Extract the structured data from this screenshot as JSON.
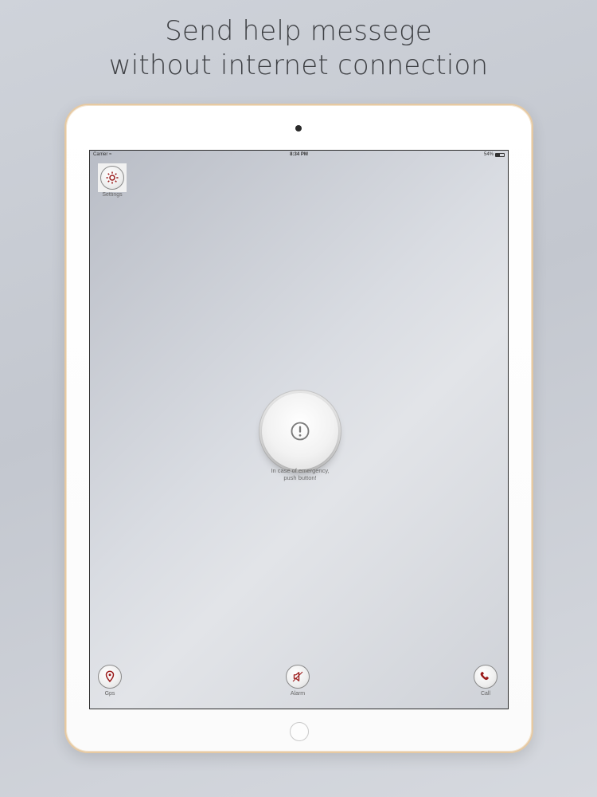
{
  "headline": {
    "line1": "Send help messege",
    "line2": "without internet connection"
  },
  "status_bar": {
    "carrier": "Carrier",
    "time": "8:34 PM",
    "battery": "54%",
    "battery_level": 0.54
  },
  "settings": {
    "label": "Settings",
    "icon": "gear-icon"
  },
  "emergency": {
    "icon": "exclamation-icon",
    "line1": "In case of emergency,",
    "line2": "push button!"
  },
  "bottom": {
    "gps": {
      "label": "Gps",
      "icon": "location-pin-icon"
    },
    "alarm": {
      "label": "Alarm",
      "icon": "speaker-icon"
    },
    "call": {
      "label": "Call",
      "icon": "phone-icon"
    }
  },
  "colors": {
    "accent": "#9b1b1b",
    "device_frame": "#e6c9a2"
  }
}
